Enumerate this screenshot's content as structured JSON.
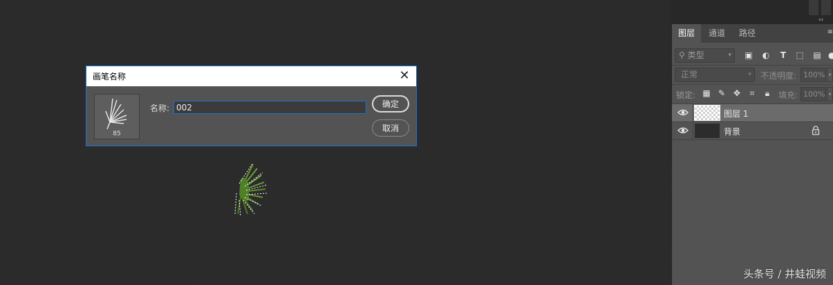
{
  "dialog": {
    "title": "画笔名称",
    "name_label": "名称:",
    "name_value": "002",
    "brush_size": "85",
    "ok_label": "确定",
    "cancel_label": "取消"
  },
  "layers_panel": {
    "tabs": [
      "图层",
      "通道",
      "路径"
    ],
    "active_tab": "图层",
    "filter_kind": "类型",
    "blend_mode": "正常",
    "opacity_label": "不透明度:",
    "opacity_value": "100%",
    "lock_label": "锁定:",
    "fill_label": "填充:",
    "fill_value": "100%",
    "layers": [
      {
        "name": "图层 1",
        "visible": true,
        "selected": true,
        "locked": false
      },
      {
        "name": "背景",
        "visible": true,
        "selected": false,
        "locked": true
      }
    ]
  },
  "watermark": "头条号 / 井蛙视频",
  "colors": {
    "canvas_bg": "#2a2a2a",
    "panel_bg": "#535353",
    "dialog_border": "#1473e6",
    "brush_green": "#5b8a2e"
  },
  "icons": {
    "filter": [
      "image-filter-icon",
      "adjustment-filter-icon",
      "type-filter-icon",
      "shape-filter-icon",
      "smart-object-filter-icon"
    ],
    "lock": [
      "lock-transparent-pixels-icon",
      "lock-image-pixels-icon",
      "lock-position-icon",
      "lock-artboard-icon",
      "lock-all-icon"
    ]
  }
}
